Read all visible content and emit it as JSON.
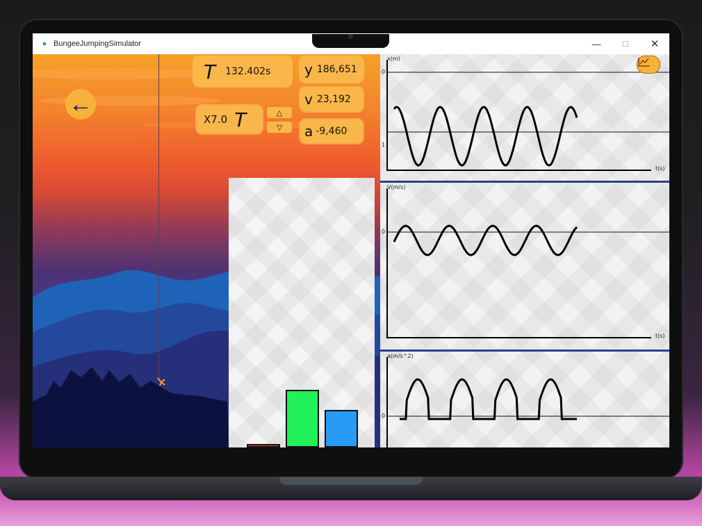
{
  "window": {
    "title": "BungeeJumpingSimulator",
    "minimize_glyph": "—",
    "maximize_glyph": "☐",
    "close_glyph": "✕"
  },
  "controls": {
    "back_glyph": "←",
    "time_symbol": "T",
    "time_value": "132.402s",
    "speed_multiplier": "X7.0",
    "speed_symbol": "T",
    "speed_up_glyph": "△",
    "speed_down_glyph": "▽",
    "y_symbol": "y",
    "y_value": "186,651",
    "v_symbol": "v",
    "v_value": "23,192",
    "a_symbol": "a",
    "a_value": "-9,460"
  },
  "energy_bars": {
    "colors": [
      "#e24b2e",
      "#22f25a",
      "#2a9bf5"
    ],
    "heights": [
      5,
      80,
      52
    ]
  },
  "graphs": {
    "toggle_icon": "chart-icon",
    "panels": [
      {
        "key": "x",
        "ylabel": "x(m)",
        "xlabel": "t(s)",
        "zero": "0",
        "extra_tick": "1"
      },
      {
        "key": "v",
        "ylabel": "V(m/s)",
        "xlabel": "t(s)",
        "zero": "0"
      },
      {
        "key": "a",
        "ylabel": "a(m/s^2)",
        "xlabel": "",
        "zero": "0"
      }
    ]
  },
  "colors": {
    "accent": "#f9b749",
    "panel_separator": "#2a3f8f"
  }
}
